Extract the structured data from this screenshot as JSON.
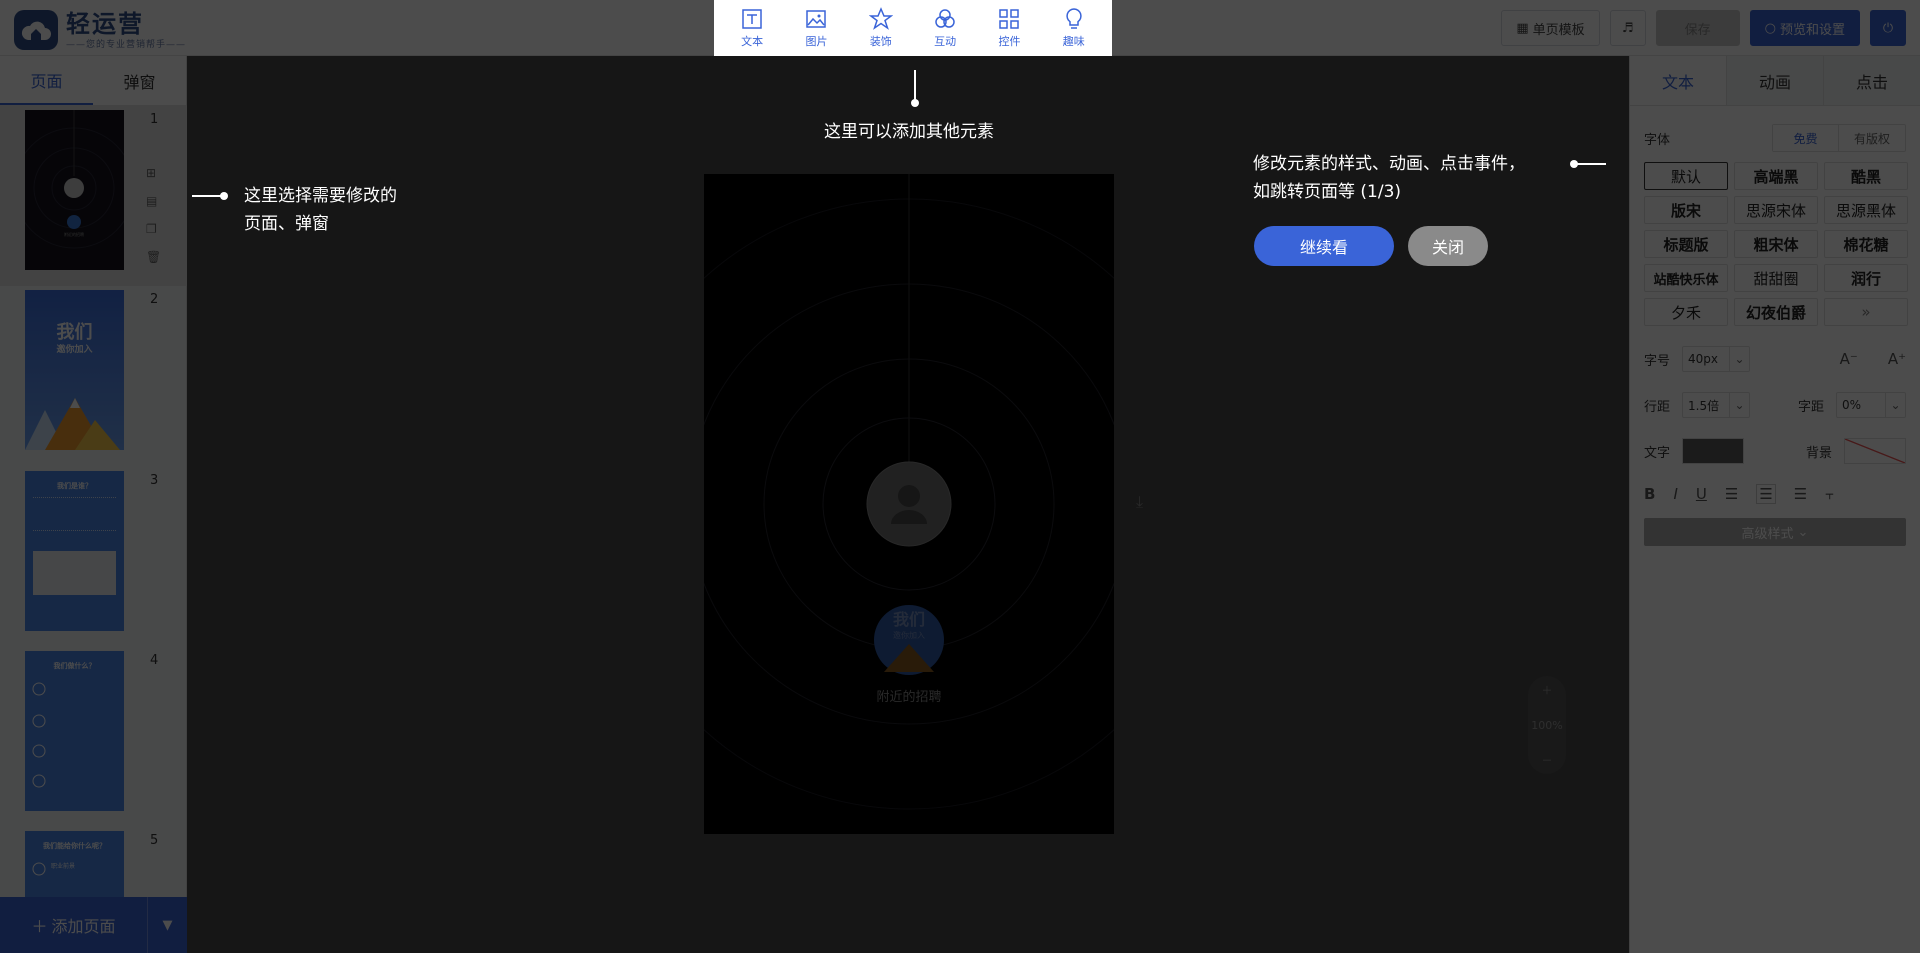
{
  "app": {
    "logo_name": "轻运营",
    "logo_tagline": "——您的专业营销帮手——"
  },
  "topbar": {
    "template_btn": "单页模板",
    "save_btn": "保存",
    "preview_btn": "预览和设置"
  },
  "element_toolbar": {
    "items": [
      {
        "label": "文本",
        "icon": "text-icon"
      },
      {
        "label": "图片",
        "icon": "image-icon"
      },
      {
        "label": "装饰",
        "icon": "star-icon"
      },
      {
        "label": "互动",
        "icon": "interact-icon"
      },
      {
        "label": "控件",
        "icon": "widget-icon"
      },
      {
        "label": "趣味",
        "icon": "bulb-icon"
      }
    ]
  },
  "left_panel": {
    "tabs": [
      "页面",
      "弹窗"
    ],
    "pages": [
      "1",
      "2",
      "3",
      "4",
      "5"
    ],
    "thumb2_title": "我们",
    "thumb2_sub": "邀你加入",
    "thumb3_title": "我们是谁？",
    "thumb4_title": "我们做什么？",
    "thumb5_title": "我们能给你什么呢？",
    "thumb5_line": "职业前景",
    "add_page": "添加页面"
  },
  "canvas": {
    "badge_title": "我们",
    "badge_sub": "邀你加入",
    "caption": "附近的招聘",
    "zoom": "100%"
  },
  "right_panel": {
    "tabs": [
      "文本",
      "动画",
      "点击"
    ],
    "font_label": "字体",
    "font_filter": [
      "免费",
      "有版权"
    ],
    "fonts": [
      "默认",
      "高端黑",
      "酷黑",
      "版宋",
      "思源宋体",
      "思源黑体",
      "标题版",
      "粗宋体",
      "棉花糖",
      "站酷快乐体",
      "甜甜圈",
      "润行",
      "夕禾",
      "幻夜伯爵",
      "»"
    ],
    "size_label": "字号",
    "size_value": "40px",
    "lineheight_label": "行距",
    "lineheight_value": "1.5倍",
    "spacing_label": "字距",
    "spacing_value": "0%",
    "text_color_label": "文字",
    "bg_label": "背景",
    "advanced": "高级样式",
    "text_color": "#5a5a5a"
  },
  "tour": {
    "tip_toolbar": "这里可以添加其他元素",
    "tip_left_1": "这里选择需要修改的",
    "tip_left_2": "页面、弹窗",
    "tip_right_1": "修改元素的样式、动画、点击事件，",
    "tip_right_2": "如跳转页面等 (1/3)",
    "continue_btn": "继续看",
    "close_btn": "关闭"
  },
  "colors": {
    "accent": "#3a64d8",
    "overlay": "rgba(0,0,0,0.70)"
  }
}
